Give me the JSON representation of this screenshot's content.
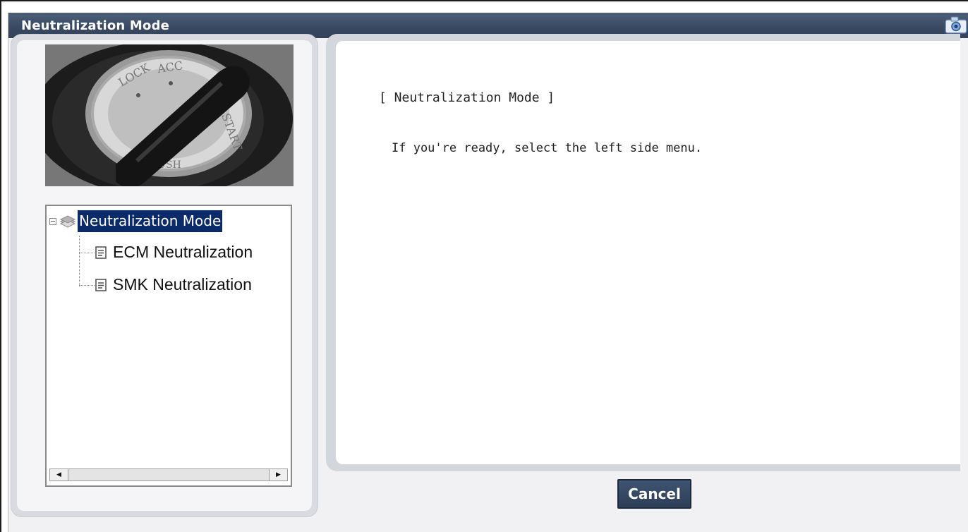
{
  "window": {
    "title": "Neutralization Mode",
    "title_icon": "camera-icon"
  },
  "tree": {
    "root": {
      "label": "Neutralization Mode",
      "icon": "stack-icon",
      "expanded": true,
      "selected": true
    },
    "items": [
      {
        "label": "ECM Neutralization",
        "icon": "document-icon"
      },
      {
        "label": "SMK Neutralization",
        "icon": "document-icon"
      }
    ]
  },
  "content": {
    "heading": "[ Neutralization Mode ]",
    "message": "If you're ready, select the left side menu."
  },
  "buttons": {
    "cancel": "Cancel"
  },
  "colors": {
    "titlebar": "#3a4a63",
    "selection": "#0b2a6a",
    "panel_frame": "#d3d6dc"
  }
}
